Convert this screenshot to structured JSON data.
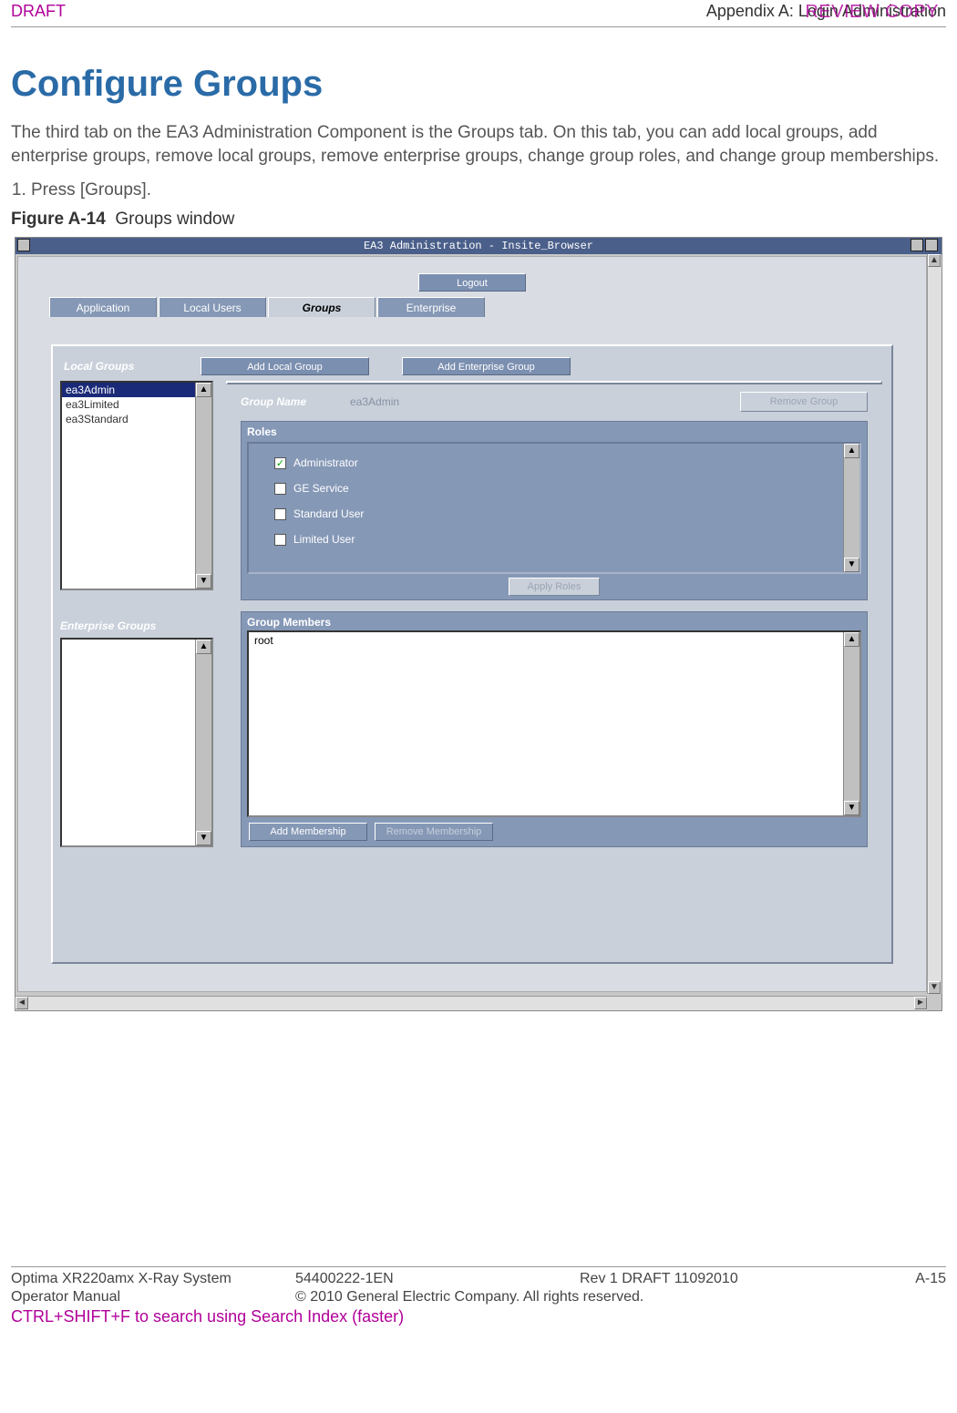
{
  "header": {
    "draft": "DRAFT",
    "review": "REVIEW COPY",
    "appendix": "Appendix A: Login Administration"
  },
  "title": "Configure Groups",
  "intro": "The third tab on the EA3 Administration Component is the Groups tab. On this tab, you can add local groups, add enterprise groups, remove local groups, remove enterprise groups, change group roles, and change group memberships.",
  "step1": "Press [Groups].",
  "figure": {
    "label": "Figure A-14",
    "caption": "Groups window"
  },
  "window": {
    "title": "EA3 Administration - Insite_Browser",
    "logout": "Logout",
    "tabs": {
      "application": "Application",
      "local_users": "Local Users",
      "groups": "Groups",
      "enterprise": "Enterprise"
    },
    "panel": {
      "local_groups_label": "Local Groups",
      "add_local_group": "Add Local Group",
      "add_enterprise_group": "Add Enterprise Group",
      "local_groups": {
        "item0": "ea3Admin",
        "item1": "ea3Limited",
        "item2": "ea3Standard"
      },
      "enterprise_groups_label": "Enterprise Groups",
      "group_name_label": "Group Name",
      "group_name_value": "ea3Admin",
      "remove_group": "Remove Group",
      "roles_label": "Roles",
      "roles": {
        "r0": "Administrator",
        "r1": "GE Service",
        "r2": "Standard User",
        "r3": "Limited User"
      },
      "apply_roles": "Apply Roles",
      "members_label": "Group Members",
      "members": {
        "m0": "root"
      },
      "add_membership": "Add Membership",
      "remove_membership": "Remove Membership"
    }
  },
  "footer": {
    "product": "Optima XR220amx X-Ray System",
    "manual": "Operator Manual",
    "docnum": "54400222-1EN",
    "rev": "Rev 1 DRAFT 11092010",
    "copyright": "© 2010 General Electric Company. All rights reserved.",
    "pagenum": "A-15",
    "search_hint": "CTRL+SHIFT+F to search using Search Index (faster)"
  }
}
